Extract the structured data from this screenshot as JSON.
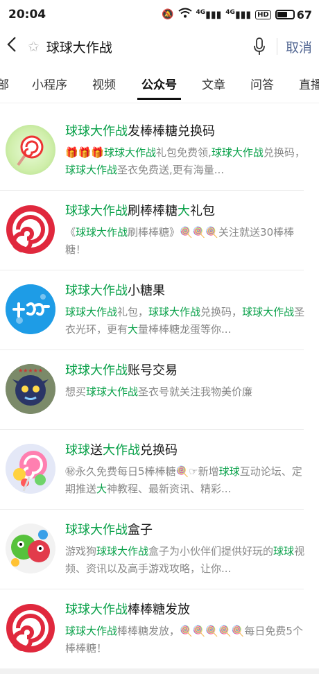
{
  "status": {
    "time": "20:04",
    "net": "4G",
    "net2": "4G",
    "hd": "HD",
    "battery": "67"
  },
  "search": {
    "query": "球球大作战",
    "cancel": "取消"
  },
  "tabs": [
    "部",
    "小程序",
    "视频",
    "公众号",
    "文章",
    "问答",
    "直播"
  ],
  "active_tab": "公众号",
  "results": [
    {
      "title": [
        {
          "t": "球球大作战",
          "h": 1
        },
        {
          "t": "发棒棒糖兑换码",
          "h": 0
        }
      ],
      "desc": [
        {
          "t": "🎁🎁🎁",
          "h": 0
        },
        {
          "t": "球球大作战",
          "h": 1
        },
        {
          "t": "礼包免费领,",
          "h": 0
        },
        {
          "t": "球球大作战",
          "h": 1
        },
        {
          "t": "兑换码，",
          "h": 0
        },
        {
          "t": "球球大作战",
          "h": 1
        },
        {
          "t": "圣衣免费送,更有海量...",
          "h": 0
        }
      ]
    },
    {
      "title": [
        {
          "t": "球球大作战",
          "h": 1
        },
        {
          "t": "刷棒棒糖",
          "h": 0
        },
        {
          "t": "大",
          "h": 1
        },
        {
          "t": "礼包",
          "h": 0
        }
      ],
      "desc": [
        {
          "t": "《",
          "h": 0
        },
        {
          "t": "球球大作战",
          "h": 1
        },
        {
          "t": "刷棒棒糖》🍭🍭🍭关注就送30棒棒糖！",
          "h": 0
        }
      ]
    },
    {
      "title": [
        {
          "t": "球球大作战",
          "h": 1
        },
        {
          "t": "小糖果",
          "h": 0
        }
      ],
      "desc": [
        {
          "t": "球球大作战",
          "h": 1
        },
        {
          "t": "礼包，",
          "h": 0
        },
        {
          "t": "球球大作战",
          "h": 1
        },
        {
          "t": "兑换码，",
          "h": 0
        },
        {
          "t": "球球大作战",
          "h": 1
        },
        {
          "t": "圣衣光环，更有",
          "h": 0
        },
        {
          "t": "大",
          "h": 1
        },
        {
          "t": "量棒棒糖龙蛋等你...",
          "h": 0
        }
      ]
    },
    {
      "title": [
        {
          "t": "球球大作战",
          "h": 1
        },
        {
          "t": "账号交易",
          "h": 0
        }
      ],
      "desc": [
        {
          "t": "想买",
          "h": 0
        },
        {
          "t": "球球大作战",
          "h": 1
        },
        {
          "t": "圣衣号就关注我物美价廉",
          "h": 0
        }
      ]
    },
    {
      "title": [
        {
          "t": "球球",
          "h": 1
        },
        {
          "t": "送",
          "h": 0
        },
        {
          "t": "大作战",
          "h": 1
        },
        {
          "t": "兑换码",
          "h": 0
        }
      ],
      "desc": [
        {
          "t": "㊙永久免费每日5棒棒糖🍭☞新增",
          "h": 0
        },
        {
          "t": "球球",
          "h": 1
        },
        {
          "t": "互动论坛、定期推送",
          "h": 0
        },
        {
          "t": "大",
          "h": 1
        },
        {
          "t": "神教程、最新资讯、精彩...",
          "h": 0
        }
      ]
    },
    {
      "title": [
        {
          "t": "球球大作战",
          "h": 1
        },
        {
          "t": "盒子",
          "h": 0
        }
      ],
      "desc": [
        {
          "t": "游戏狗",
          "h": 0
        },
        {
          "t": "球球大作战",
          "h": 1
        },
        {
          "t": "盒子为小伙伴们提供好玩的",
          "h": 0
        },
        {
          "t": "球球",
          "h": 1
        },
        {
          "t": "视频、资讯以及高手游戏攻略，让你...",
          "h": 0
        }
      ]
    },
    {
      "title": [
        {
          "t": "球球大作战",
          "h": 1
        },
        {
          "t": "棒棒糖发放",
          "h": 0
        }
      ],
      "desc": [
        {
          "t": "球球大作战",
          "h": 1
        },
        {
          "t": "棒棒糖发放，🍭🍭🍭🍭🍭每日免费5个棒棒糖！",
          "h": 0
        }
      ]
    }
  ],
  "avatar_icons": [
    "lollipop-icon",
    "lollipop-icon",
    "candy-logo-icon",
    "monster-icon",
    "candy-icon",
    "monster-icon",
    "lollipop-icon"
  ],
  "colors": {
    "highlight": "#07a048",
    "link": "#576b95"
  }
}
